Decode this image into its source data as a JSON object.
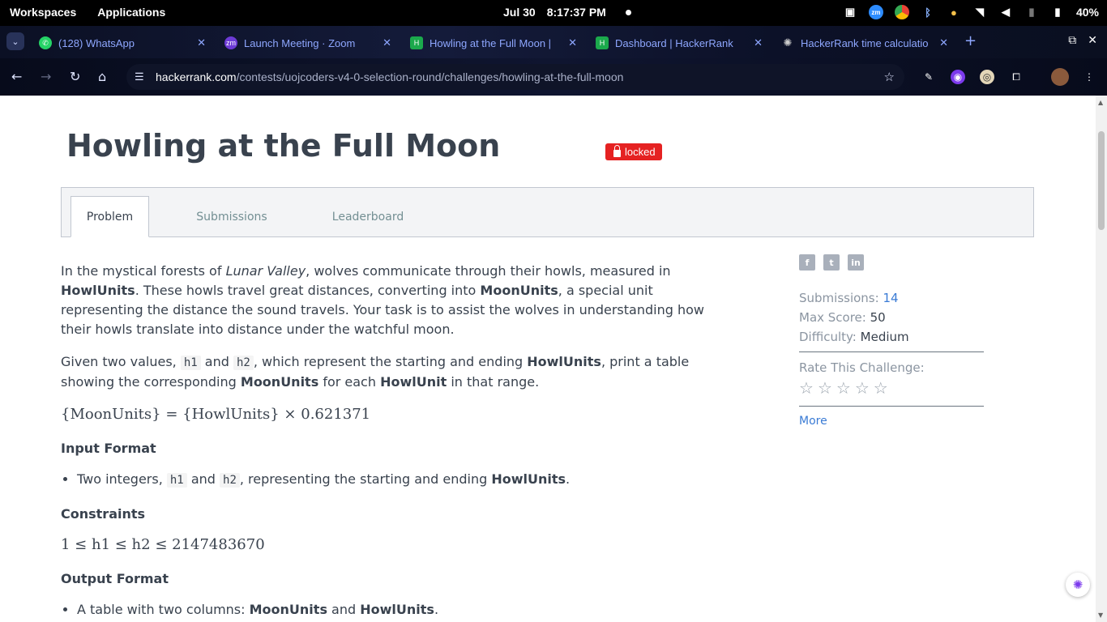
{
  "system": {
    "workspaces": "Workspaces",
    "applications": "Applications",
    "date": "Jul 30",
    "time": "8:17:37 PM",
    "battery": "40%"
  },
  "browser": {
    "tabs": [
      {
        "title": "(128) WhatsApp",
        "fav_color": "#25d366"
      },
      {
        "title": "Launch Meeting · Zoom",
        "fav_color": "#6d3bd6"
      },
      {
        "title": "Howling at the Full Moon |",
        "fav_color": "#1ba94c"
      },
      {
        "title": "Dashboard | HackerRank",
        "fav_color": "#1ba94c"
      },
      {
        "title": "HackerRank time calculatio",
        "fav_color": "#cccccc"
      }
    ],
    "url_domain": "hackerrank.com",
    "url_path": "/contests/uojcoders-v4-0-selection-round/challenges/howling-at-the-full-moon"
  },
  "challenge": {
    "title": "Howling at the Full Moon",
    "locked_label": "locked",
    "tabs": [
      "Problem",
      "Submissions",
      "Leaderboard"
    ],
    "p1_a": "In the mystical forests of ",
    "p1_lunar": "Lunar Valley",
    "p1_b": ", wolves communicate through their howls, measured in ",
    "howl": "HowlUnits",
    "p1_c": ". These howls travel great distances, converting into ",
    "moon": "MoonUnits",
    "p1_d": ", a special unit representing the distance the sound travels. Your task is to assist the wolves in understanding how their howls translate into distance under the watchful moon.",
    "p2_a": "Given two values, ",
    "h1": "h1",
    "and": " and ",
    "h2": "h2",
    "p2_b": ", which represent the starting and ending ",
    "p2_c": ", print a table showing the corresponding ",
    "p2_d": " for each ",
    "howl_single": "HowlUnit",
    "p2_e": " in that range.",
    "formula": "{MoonUnits} = {HowlUnits} × 0.621371",
    "input_heading": "Input Format",
    "input_a": "Two integers, ",
    "input_b": ", representing the starting and ending ",
    "period": ".",
    "constraints_heading": "Constraints",
    "constraint": "1 ≤ h1 ≤ h2 ≤ 2147483670",
    "output_heading": "Output Format",
    "output_a": "A table with two columns: ",
    "output_and": " and "
  },
  "sidebar": {
    "social": [
      "f",
      "t",
      "in"
    ],
    "submissions_label": "Submissions:",
    "submissions_value": "14",
    "max_score_label": "Max Score:",
    "max_score_value": "50",
    "difficulty_label": "Difficulty:",
    "difficulty_value": "Medium",
    "rate_label": "Rate This Challenge:",
    "stars": 0,
    "more": "More"
  }
}
